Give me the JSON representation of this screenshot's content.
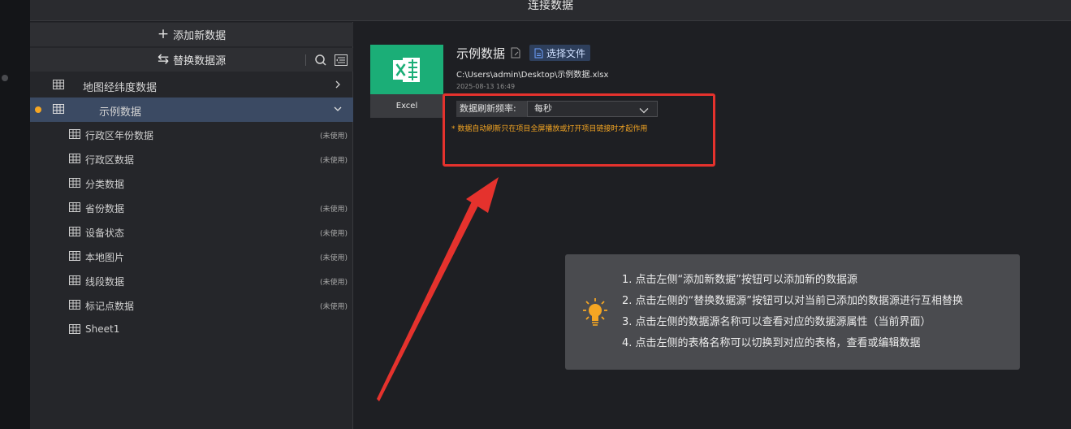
{
  "window": {
    "title": "连接数据"
  },
  "sidebar": {
    "add_label": "添加新数据",
    "switch_label": "替换数据源",
    "sources": [
      {
        "name": "地图经纬度数据",
        "expanded": false,
        "active": false
      },
      {
        "name": "示例数据",
        "expanded": true,
        "active": true
      }
    ],
    "sheets": [
      {
        "name": "行政区年份数据",
        "status": "(未使用)"
      },
      {
        "name": "行政区数据",
        "status": "(未使用)"
      },
      {
        "name": "分类数据",
        "status": ""
      },
      {
        "name": "省份数据",
        "status": "(未使用)"
      },
      {
        "name": "设备状态",
        "status": "(未使用)"
      },
      {
        "name": "本地图片",
        "status": "(未使用)"
      },
      {
        "name": "线段数据",
        "status": "(未使用)"
      },
      {
        "name": "标记点数据",
        "status": "(未使用)"
      },
      {
        "name": "Sheet1",
        "status": ""
      }
    ]
  },
  "detail": {
    "file_type": "Excel",
    "title": "示例数据",
    "choose_file_label": "选择文件",
    "path": "C:\\Users\\admin\\Desktop\\示例数据.xlsx",
    "date": "2025-08-13 16:49",
    "refresh_label": "数据刷新频率:",
    "refresh_value": "每秒",
    "refresh_note": "* 数据自动刷新只在项目全屏播放或打开项目链接时才起作用"
  },
  "tips": [
    "1. 点击左侧“添加新数据”按钮可以添加新的数据源",
    "2. 点击左侧的“替换数据源”按钮可以对当前已添加的数据源进行互相替换",
    "3. 点击左侧的数据源名称可以查看对应的数据源属性（当前界面）",
    "4. 点击左侧的表格名称可以切换到对应的表格，查看或编辑数据"
  ],
  "colors": {
    "accent_orange": "#f5a623",
    "excel_green": "#1bae77",
    "highlight_red": "#e5322d",
    "active_row": "#3b4a63"
  }
}
